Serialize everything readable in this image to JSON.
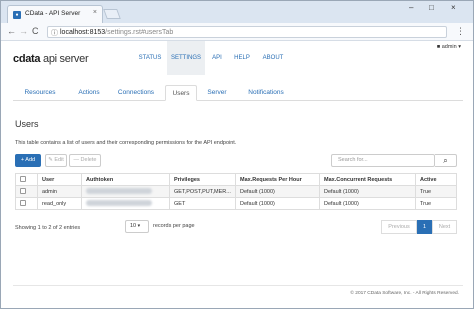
{
  "browser": {
    "tab_title": "CData - API Server",
    "tab_close": "×",
    "url_host": "localhost:8153",
    "url_path": "/settings.rst#usersTab",
    "url_icon": "ⓘ",
    "menu_dots": "⋮",
    "win_min": "–",
    "win_max": "□",
    "win_close": "×",
    "nav_back": "←",
    "nav_forward": "→",
    "nav_reload": "C"
  },
  "header": {
    "logo_main": "cdata",
    "logo_sub": "api server",
    "nav": [
      "STATUS",
      "SETTINGS",
      "API",
      "HELP",
      "ABOUT"
    ],
    "active_nav": "SETTINGS",
    "user": "admin ▾",
    "user_icon": "person-icon"
  },
  "subtabs": [
    "Resources",
    "Actions",
    "Connections",
    "Users",
    "Server",
    "Notifications"
  ],
  "active_subtab": "Users",
  "section": {
    "title": "Users",
    "description": "This table contains a list of users and their corresponding permissions for the API endpoint."
  },
  "toolbar": {
    "add_label": "+ Add",
    "edit_label": "✎ Edit",
    "delete_label": "— Delete",
    "search_placeholder": "Search for...",
    "search_icon": "⌕"
  },
  "table": {
    "columns": [
      "",
      "User",
      "Authtoken",
      "Privileges",
      "Max.Requests Per Hour",
      "Max.Concurrent Requests",
      "Active"
    ],
    "rows": [
      {
        "user": "admin",
        "privileges": "GET,POST,PUT,MER...",
        "max_requests": "Default (1000)",
        "max_concurrent": "Default (1000)",
        "active": "True"
      },
      {
        "user": "read_only",
        "privileges": "GET",
        "max_requests": "Default (1000)",
        "max_concurrent": "Default (1000)",
        "active": "True"
      }
    ]
  },
  "pagination": {
    "showing": "Showing 1 to 2 of 2 entries",
    "page_size": "10",
    "page_size_arrow": "▾",
    "records_label": "records per page",
    "previous": "Previous",
    "current": "1",
    "next": "Next"
  },
  "footer": {
    "copyright": "© 2017 CData Software, Inc. - All Rights Reserved."
  },
  "colors": {
    "accent": "#2a6fb5"
  }
}
